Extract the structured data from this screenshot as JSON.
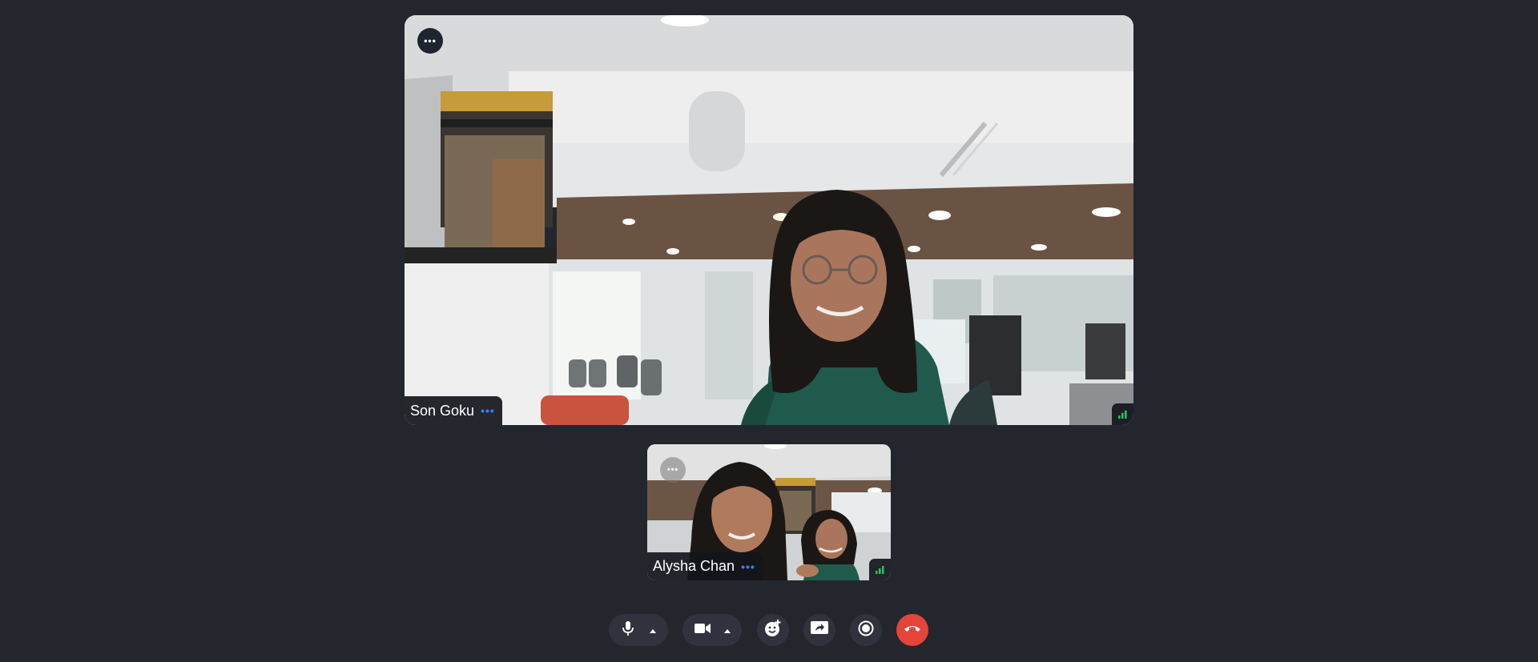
{
  "main_participant": {
    "name": "Son Goku",
    "more_label": "•••",
    "name_menu_label": "•••"
  },
  "self_view": {
    "name": "Alysha Chan",
    "more_label": "•••",
    "name_menu_label": "•••"
  },
  "toolbar": {
    "mic": "microphone-icon",
    "mic_options": "chevron-up-icon",
    "camera": "video-camera-icon",
    "camera_options": "chevron-up-icon",
    "reactions": "emoji-add-icon",
    "share_screen": "screen-share-icon",
    "record": "record-icon",
    "end_call": "phone-hangup-icon"
  },
  "colors": {
    "background": "#24262e",
    "control_bg": "#30333d",
    "end_call": "#e5443a",
    "accent_blue": "#3b82f6",
    "signal_green": "#22c55e"
  }
}
